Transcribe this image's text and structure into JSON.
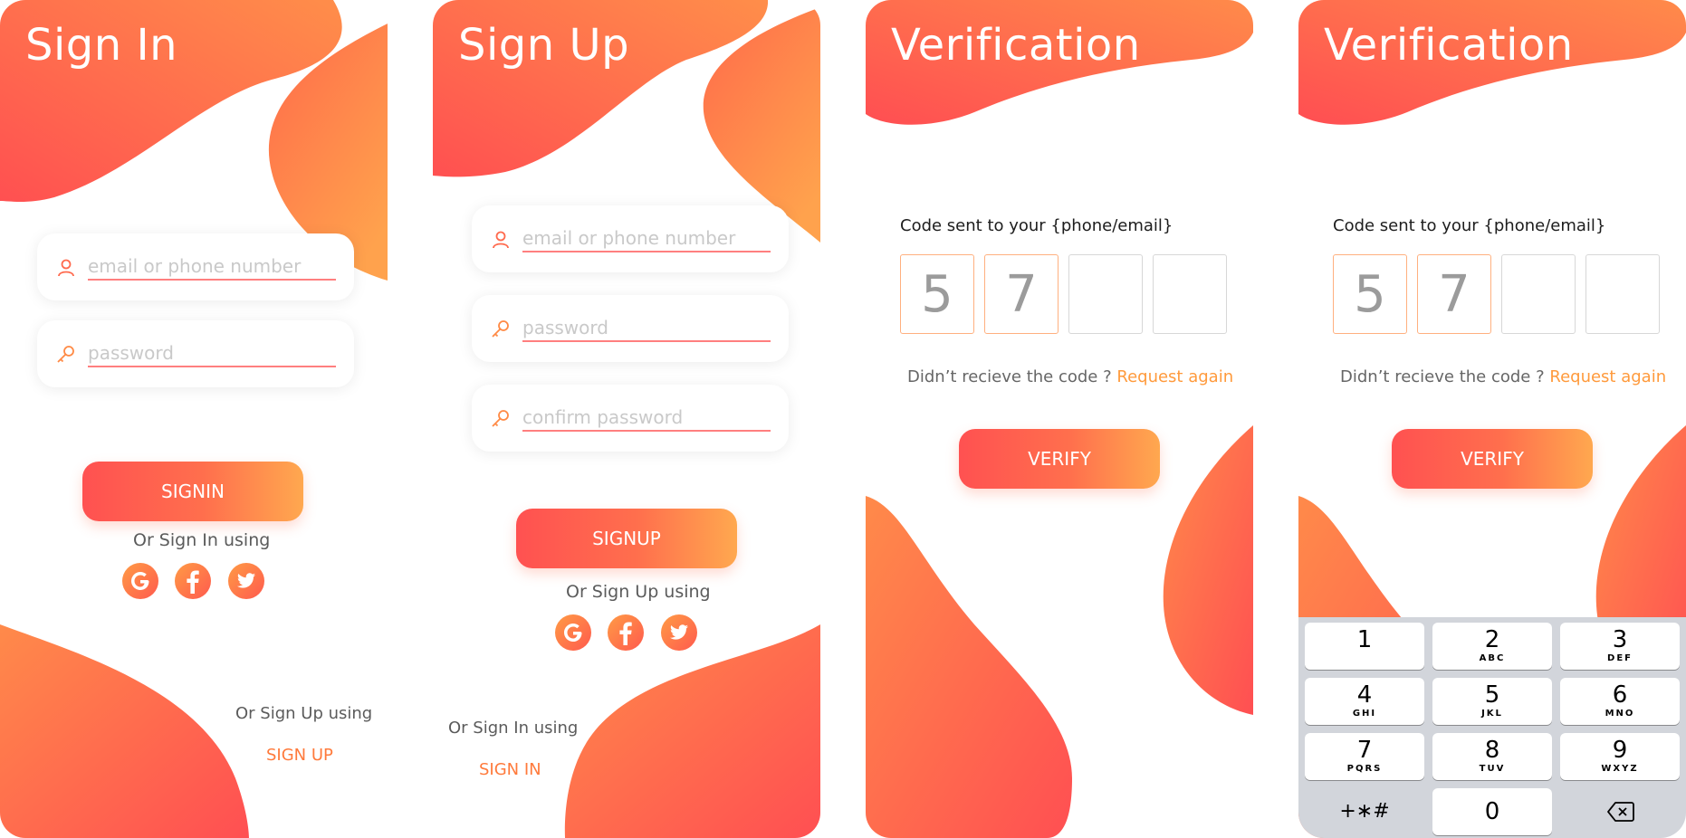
{
  "colors": {
    "accent_start": "#ff5151",
    "accent_end": "#ffa84f",
    "link": "#ff7a3b"
  },
  "signin": {
    "title": "Sign In",
    "email_placeholder": "email or phone number",
    "password_placeholder": "password",
    "button_label": "SIGNIN",
    "alt_label": "Or Sign In using",
    "social": [
      "google-icon",
      "facebook-icon",
      "twitter-icon"
    ],
    "signup_prompt": "Or Sign Up using",
    "signup_link": "SIGN UP"
  },
  "signup": {
    "title": "Sign Up",
    "email_placeholder": "email or phone number",
    "password_placeholder": "password",
    "confirm_placeholder": "confirm password",
    "button_label": "SIGNUP",
    "alt_label": "Or Sign Up using",
    "social": [
      "google-icon",
      "facebook-icon",
      "twitter-icon"
    ],
    "signin_prompt": "Or Sign In using",
    "signin_link": "SIGN IN"
  },
  "verify1": {
    "title": "Verification",
    "code_label": "Code sent to your {phone/email}",
    "digits": [
      "5",
      "7",
      "",
      ""
    ],
    "resend_text": "Didn’t recieve the code ? ",
    "resend_link": "Request again",
    "button_label": "VERIFY"
  },
  "verify2": {
    "title": "Verification",
    "code_label": "Code sent to your {phone/email}",
    "digits": [
      "5",
      "7",
      "",
      ""
    ],
    "resend_text": "Didn’t recieve the code ? ",
    "resend_link": "Request again",
    "button_label": "VERIFY"
  },
  "keypad": {
    "keys": [
      {
        "num": "1",
        "letters": ""
      },
      {
        "num": "2",
        "letters": "ABC"
      },
      {
        "num": "3",
        "letters": "DEF"
      },
      {
        "num": "4",
        "letters": "GHI"
      },
      {
        "num": "5",
        "letters": "JKL"
      },
      {
        "num": "6",
        "letters": "MNO"
      },
      {
        "num": "7",
        "letters": "PQRS"
      },
      {
        "num": "8",
        "letters": "TUV"
      },
      {
        "num": "9",
        "letters": "WXYZ"
      }
    ],
    "symbols": "+∗#",
    "zero": "0",
    "delete_icon": "backspace-icon"
  }
}
